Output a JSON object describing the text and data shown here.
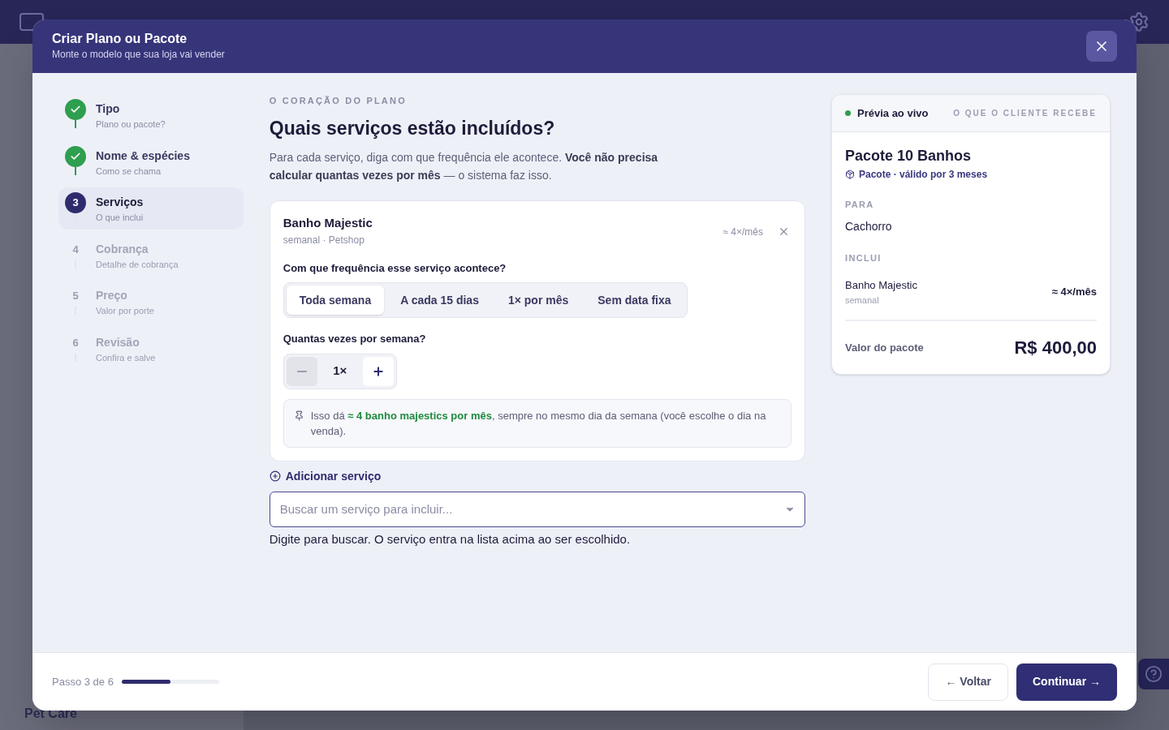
{
  "background": {
    "sidebar_label": "Pet Care"
  },
  "modal": {
    "title": "Criar Plano ou Pacote",
    "subtitle": "Monte o modelo que sua loja vai vender"
  },
  "steps": [
    {
      "title": "Tipo",
      "subtitle": "Plano ou pacote?",
      "done": true,
      "selected": false
    },
    {
      "title": "Nome & espécies",
      "subtitle": "Como se chama",
      "done": true,
      "selected": false
    },
    {
      "number": "3",
      "title": "Serviços",
      "subtitle": "O que inclui",
      "done": false,
      "selected": true
    },
    {
      "number": "4",
      "title": "Cobrança",
      "subtitle": "Detalhe de cobrança",
      "done": false,
      "selected": false
    },
    {
      "number": "5",
      "title": "Preço",
      "subtitle": "Valor por porte",
      "done": false,
      "selected": false
    },
    {
      "number": "6",
      "title": "Revisão",
      "subtitle": "Confira e salve",
      "done": false,
      "selected": false
    }
  ],
  "section": {
    "eyebrow": "O CORAÇÃO DO PLANO",
    "title": "Quais serviços estão incluídos?",
    "description": "Para cada serviço, diga com que frequência ele acontece. **Você não precisa calcular quantas vezes por mês** — o sistema faz isso."
  },
  "services": [
    {
      "name": "Banho Majestic",
      "meta": "semanal · Petshop",
      "estimate": "≈ 4×/mês",
      "frequency_label": "Com que frequência esse serviço acontece?",
      "frequency_options": [
        {
          "label": "Toda semana",
          "selected": true
        },
        {
          "label": "A cada 15 dias",
          "selected": false
        },
        {
          "label": "1× por mês",
          "selected": false
        },
        {
          "label": "Sem data fixa",
          "selected": false
        }
      ],
      "count_label": "Quantas vezes por semana?",
      "count": "1×",
      "decrement_disabled": true,
      "note": "Isso dá **≈ 4 banho majestics por mês**, sempre no mesmo dia da semana (você escolhe o dia na venda)."
    }
  ],
  "add_service": {
    "label": "Adicionar serviço",
    "placeholder": "Buscar um serviço para incluir...",
    "help": "Digite para buscar. O serviço entra na lista acima ao ser escolhido."
  },
  "preview": {
    "live_label": "Prévia ao vivo",
    "caption": "O QUE O CLIENTE RECEBE",
    "name": "Pacote 10 Banhos",
    "type_line": "Pacote · válido por 3 meses",
    "for_label": "PARA",
    "for_value": "Cachorro",
    "includes_label": "INCLUI",
    "items": [
      {
        "name": "Banho Majestic",
        "frequency": "semanal",
        "estimate": "≈ 4×/mês"
      }
    ],
    "total_label": "Valor do pacote",
    "total": "R$ 400,00"
  },
  "footer": {
    "progress_text": "Passo 3 de 6",
    "progress": {
      "level": 0.5
    },
    "back": "← Voltar",
    "next": "Continuar →"
  }
}
